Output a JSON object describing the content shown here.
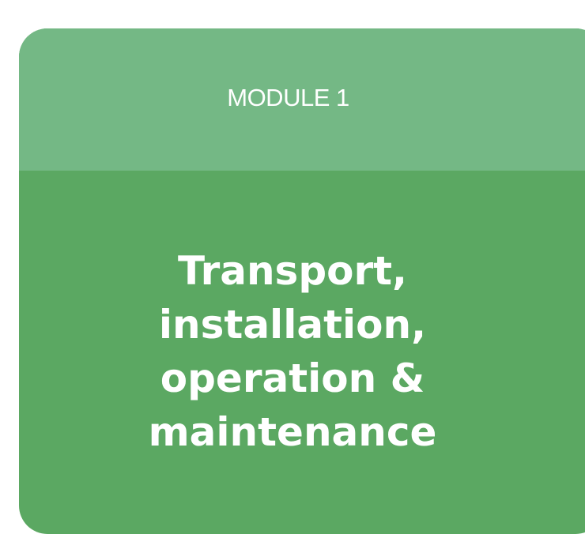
{
  "card": {
    "module_label": "MODULE 1",
    "title_lines": [
      "Transport,",
      "installation,",
      "operation &",
      "maintenance"
    ],
    "colors": {
      "header_bg": "#74b885",
      "body_bg": "#5ba862",
      "text": "#ffffff",
      "page_bg": "#ffffff"
    }
  }
}
